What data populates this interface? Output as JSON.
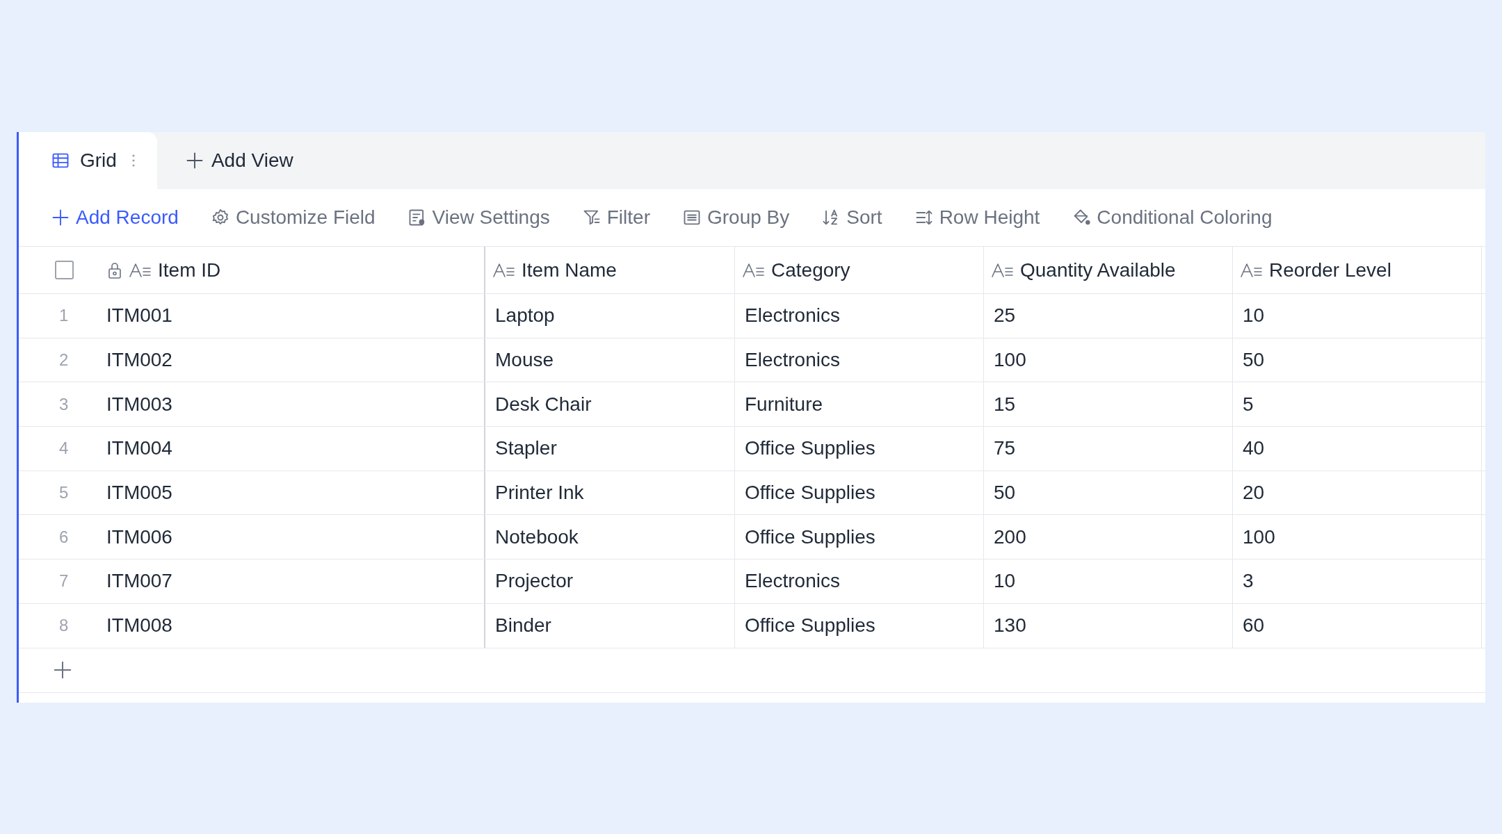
{
  "tabs": [
    {
      "label": "Grid",
      "selected": true
    }
  ],
  "add_view": {
    "label": "Add View"
  },
  "toolbar": [
    {
      "kind": "add",
      "label": "Add Record"
    },
    {
      "kind": "gear",
      "label": "Customize Field"
    },
    {
      "kind": "settings",
      "label": "View Settings"
    },
    {
      "kind": "filter",
      "label": "Filter"
    },
    {
      "kind": "group",
      "label": "Group By"
    },
    {
      "kind": "sort",
      "label": "Sort"
    },
    {
      "kind": "height",
      "label": "Row Height"
    },
    {
      "kind": "paint",
      "label": "Conditional Coloring"
    }
  ],
  "table": {
    "select_all": {
      "checked": false
    },
    "columns": [
      {
        "label": "Item ID",
        "locked": true
      },
      {
        "label": "Item Name",
        "locked": false
      },
      {
        "label": "Category",
        "locked": false
      },
      {
        "label": "Quantity Available",
        "locked": false
      },
      {
        "label": "Reorder Level",
        "locked": false
      }
    ],
    "rows": [
      {
        "number": "1",
        "cells": [
          "ITM001",
          "Laptop",
          "Electronics",
          "25",
          "10"
        ]
      },
      {
        "number": "2",
        "cells": [
          "ITM002",
          "Mouse",
          "Electronics",
          "100",
          "50"
        ]
      },
      {
        "number": "3",
        "cells": [
          "ITM003",
          "Desk Chair",
          "Furniture",
          "15",
          "5"
        ]
      },
      {
        "number": "4",
        "cells": [
          "ITM004",
          "Stapler",
          "Office Supplies",
          "75",
          "40"
        ]
      },
      {
        "number": "5",
        "cells": [
          "ITM005",
          "Printer Ink",
          "Office Supplies",
          "50",
          "20"
        ]
      },
      {
        "number": "6",
        "cells": [
          "ITM006",
          "Notebook",
          "Office Supplies",
          "200",
          "100"
        ]
      },
      {
        "number": "7",
        "cells": [
          "ITM007",
          "Projector",
          "Electronics",
          "10",
          "3"
        ]
      },
      {
        "number": "8",
        "cells": [
          "ITM008",
          "Binder",
          "Office Supplies",
          "130",
          "60"
        ]
      }
    ]
  }
}
